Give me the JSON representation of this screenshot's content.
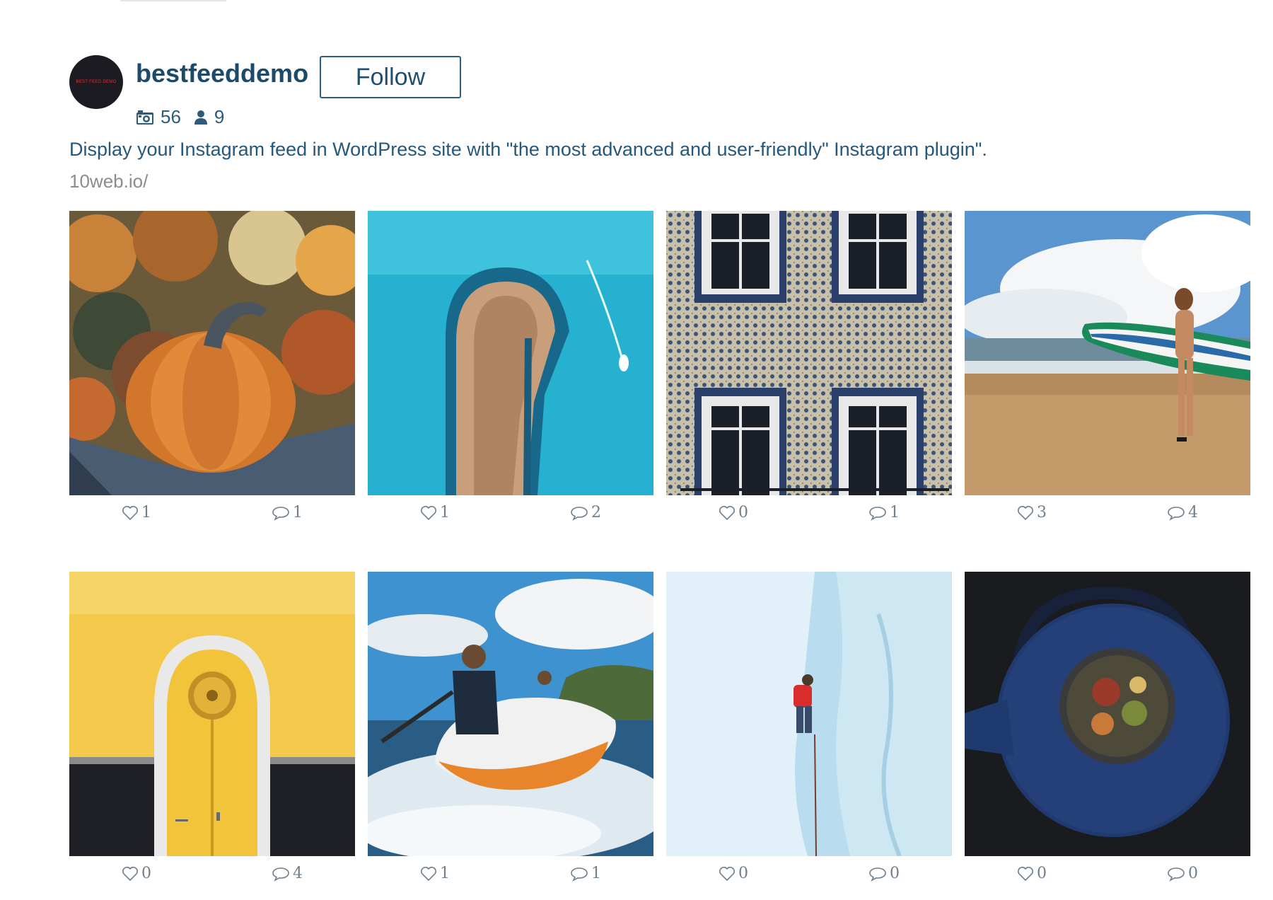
{
  "profile": {
    "avatar_text": "BEST FEED DEMO",
    "username": "bestfeeddemo",
    "follow_label": "Follow",
    "media_count": "56",
    "followers_count": "9",
    "bio": "Display your Instagram feed in WordPress site with \"the most advanced and user-friendly\" Instagram plugin\".",
    "website": "10web.io/"
  },
  "icons": {
    "media": "camera-icon",
    "followers": "user-icon",
    "likes": "heart-outline-icon",
    "comments": "speech-bubble-icon"
  },
  "colors": {
    "accent": "#1c4a6a",
    "text": "#24587c",
    "muted": "#8c8c8c"
  },
  "posts": [
    {
      "subject": "pumpkins",
      "likes": "1",
      "comments": "1"
    },
    {
      "subject": "breakwater-aerial",
      "likes": "1",
      "comments": "2"
    },
    {
      "subject": "tiled-facade-windows",
      "likes": "0",
      "comments": "1"
    },
    {
      "subject": "surfer-beach",
      "likes": "3",
      "comments": "4"
    },
    {
      "subject": "yellow-door",
      "likes": "0",
      "comments": "4"
    },
    {
      "subject": "inflatable-boat",
      "likes": "1",
      "comments": "1"
    },
    {
      "subject": "ice-climber",
      "likes": "0",
      "comments": "0"
    },
    {
      "subject": "teapot",
      "likes": "0",
      "comments": "0"
    }
  ]
}
